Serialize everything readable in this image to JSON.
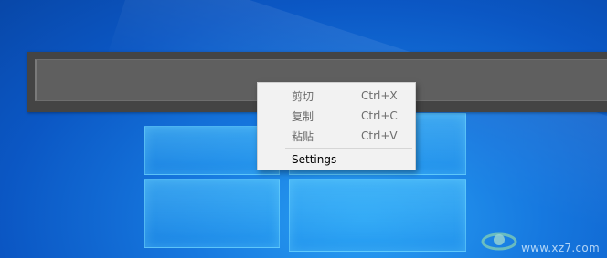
{
  "toolbar": {
    "input_value": ""
  },
  "context_menu": {
    "items": [
      {
        "label": "剪切",
        "shortcut": "Ctrl+X",
        "enabled": false
      },
      {
        "label": "复制",
        "shortcut": "Ctrl+C",
        "enabled": false
      },
      {
        "label": "粘贴",
        "shortcut": "Ctrl+V",
        "enabled": false
      },
      {
        "label": "Settings",
        "shortcut": "",
        "enabled": true
      }
    ]
  },
  "watermark": {
    "text": "www.xz7.com",
    "logo_icon": "xz7-logo-icon"
  },
  "colors": {
    "desktop_blue": "#1678df",
    "toolbar_bg": "#444444",
    "input_bg": "#5f5f5f",
    "menu_bg": "#f2f2f2",
    "menu_disabled_text": "#6d6d6d"
  }
}
